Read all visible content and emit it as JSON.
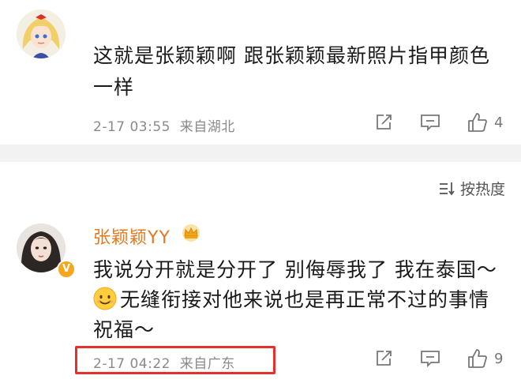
{
  "comments": [
    {
      "text_line1": "这就是张颖颖啊 跟张颖颖最新照片指甲颜色",
      "text_line2": "一样",
      "time": "2-17 03:55",
      "location": "来自湖北",
      "like_count": "4"
    },
    {
      "username": "张颖颖YY",
      "text_line1": "我说分开就是分开了 别侮辱我了 我在泰国～",
      "text_line2": "无缝衔接对他来说也是再正常不过的事情",
      "text_line3": "祝福～",
      "time": "2-17 04:22",
      "location": "来自广东",
      "like_count": "9",
      "verified_badge": "V"
    }
  ],
  "sort": {
    "label": "按热度"
  },
  "colors": {
    "username": "#e07a1f",
    "highlight": "#e8302a",
    "meta": "#8a8a8a"
  }
}
